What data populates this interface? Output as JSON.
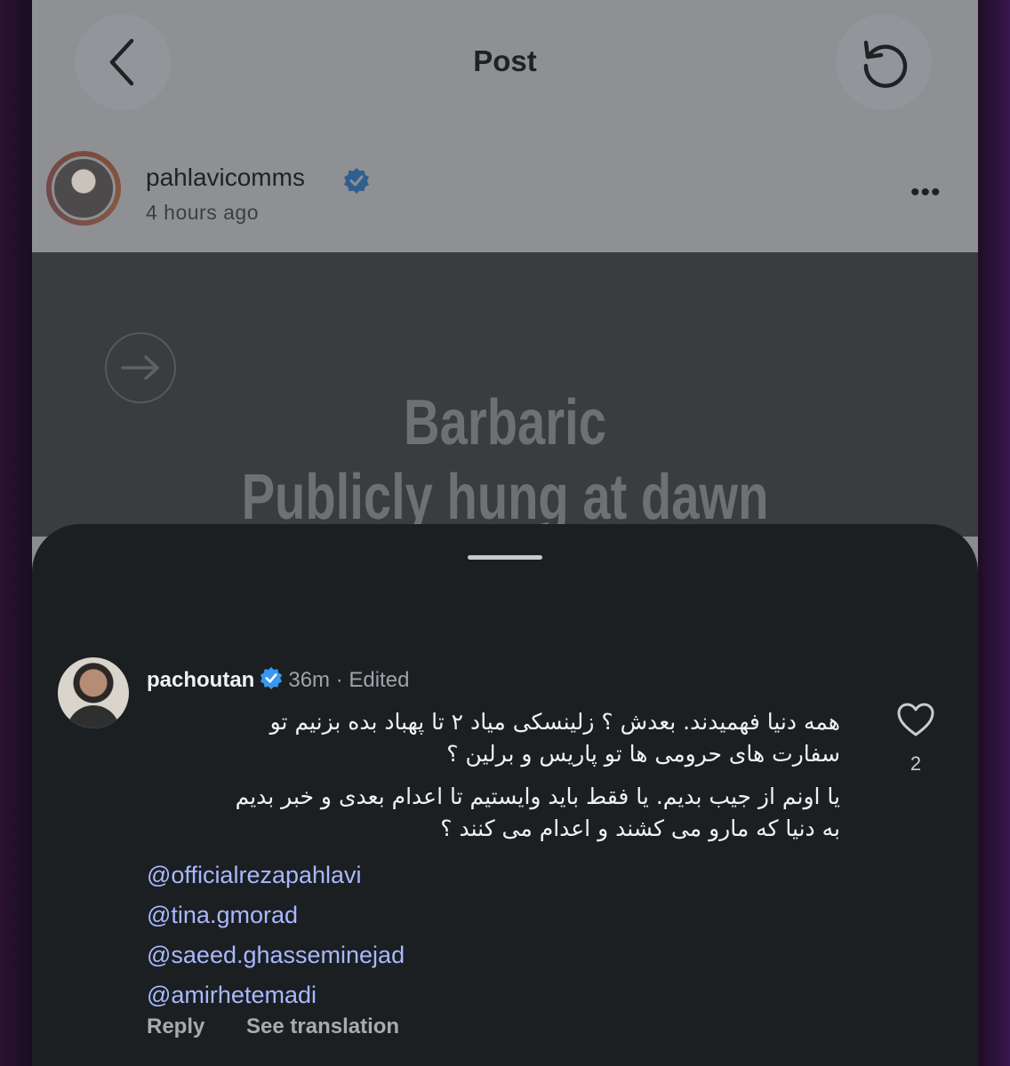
{
  "header": {
    "title": "Post",
    "back_icon": "chevron-left-icon",
    "refresh_icon": "refresh-icon"
  },
  "author": {
    "username": "pahlavicomms",
    "time_ago": "4 hours ago",
    "verified": true,
    "more_label": "•••"
  },
  "post": {
    "headline_line1": "Barbaric",
    "headline_line2": "Publicly hung at dawn",
    "next_icon": "arrow-right-icon"
  },
  "comment": {
    "username": "pachoutan",
    "time": "36m",
    "edited": "Edited",
    "line1": "همه دنیا فهمیدند. بعدش ؟ زلینسکی میاد ۲ تا پهباد بده بزنیم تو",
    "line2": "سفارت های حرومی ها تو پاریس و برلین ؟",
    "line3": "یا اونم از جیب بدیم. یا فقط باید وایستیم تا اعدام بعدی و خبر بدیم",
    "line4": "به دنیا که مارو می کشند و اعدام می کنند ؟",
    "mentions": [
      "@officialrezapahlavi",
      "@tina.gmorad",
      "@saeed.ghasseminejad",
      "@amirhetemadi"
    ],
    "like_count": "2",
    "reply_label": "Reply",
    "translate_label": "See translation"
  },
  "colors": {
    "sheet_bg": "#1b1f22",
    "mention": "#a9b8ff",
    "verified": "#3897f0"
  }
}
